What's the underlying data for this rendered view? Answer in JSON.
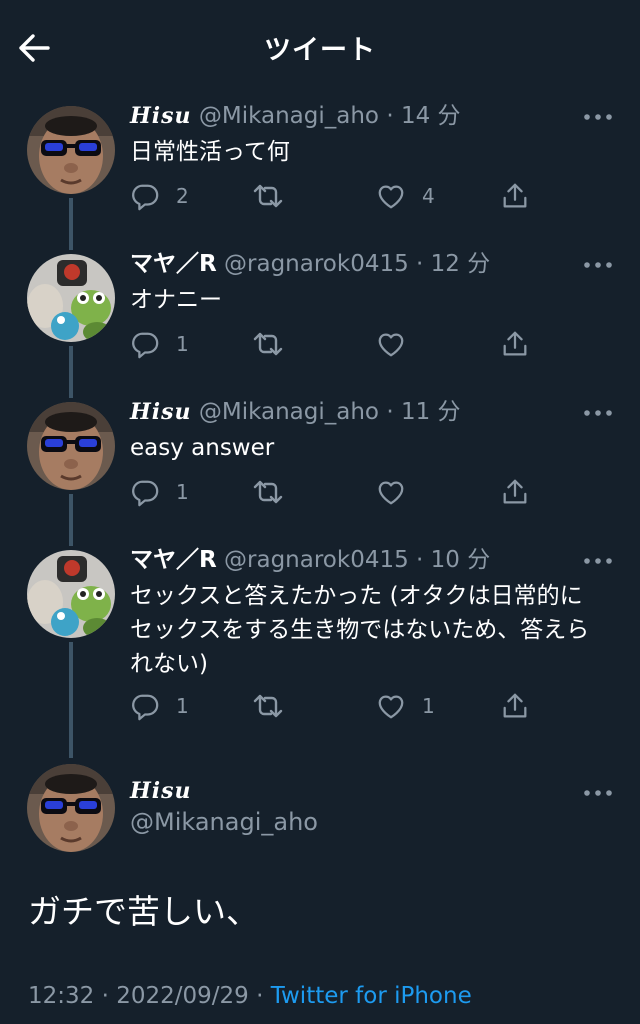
{
  "header": {
    "title": "ツイート",
    "back_icon": "arrow-left-icon"
  },
  "colors": {
    "background": "#15202b",
    "secondary_text": "#8b98a5",
    "link": "#1d9bf0",
    "thread_line": "#3d5466"
  },
  "thread": [
    {
      "name": "Hisu",
      "handle": "@Mikanagi_aho",
      "separator": "·",
      "time": "14 分",
      "text": "日常性活って何",
      "replies": "2",
      "retweets": "",
      "likes": "4"
    },
    {
      "name": "マヤ／R",
      "handle": "@ragnarok0415",
      "separator": "·",
      "time": "12 分",
      "text": "オナニー",
      "replies": "1",
      "retweets": "",
      "likes": ""
    },
    {
      "name": "Hisu",
      "handle": "@Mikanagi_aho",
      "separator": "·",
      "time": "11 分",
      "text": "easy answer",
      "replies": "1",
      "retweets": "",
      "likes": ""
    },
    {
      "name": "マヤ／R",
      "handle": "@ragnarok0415",
      "separator": "·",
      "time": "10 分",
      "text_lines": [
        "セックスと答えたかった (オタクは日常的に",
        "セックスをする生き物ではないため、答えら",
        "れない)"
      ],
      "replies": "1",
      "retweets": "",
      "likes": "1"
    }
  ],
  "main_tweet": {
    "name": "Hisu",
    "handle": "@Mikanagi_aho",
    "text": "ガチで苦しい、",
    "time": "12:32",
    "separator": "·",
    "date": "2022/09/29",
    "separator2": "·",
    "client": "Twitter for iPhone"
  },
  "icons": {
    "reply": "reply-icon",
    "retweet": "retweet-icon",
    "like": "heart-icon",
    "share": "share-icon",
    "more": "more-icon"
  }
}
